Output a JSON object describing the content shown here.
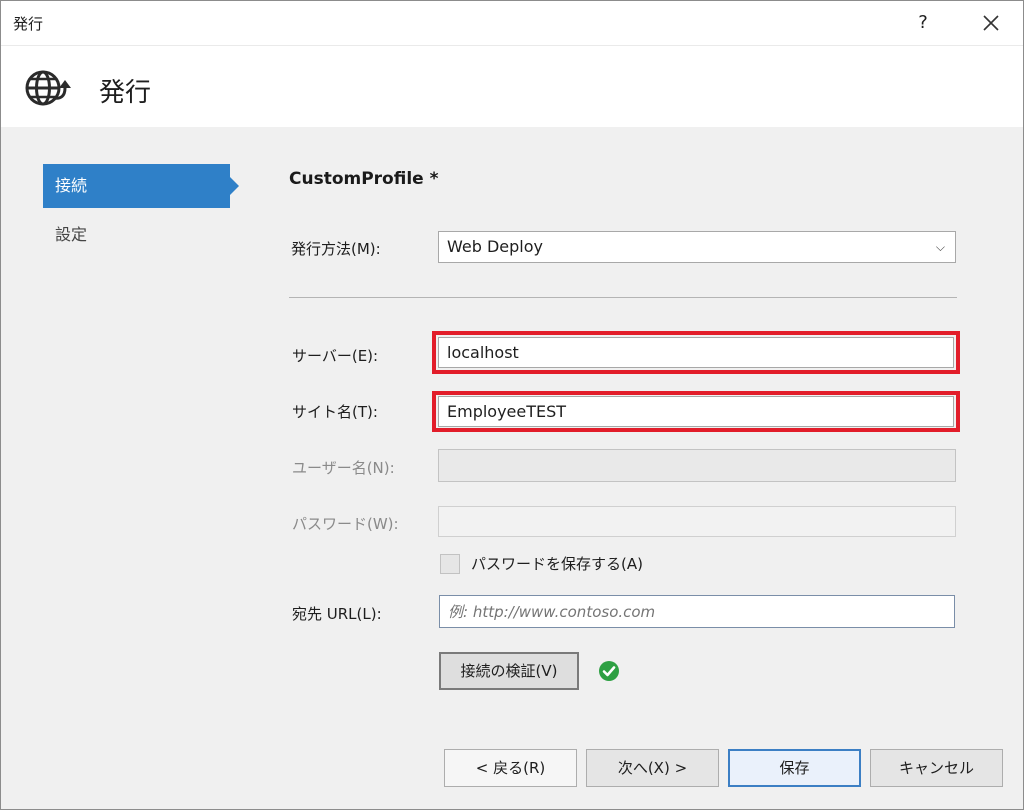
{
  "window": {
    "title": "発行",
    "help_label": "?",
    "heading": "発行"
  },
  "nav": {
    "items": [
      {
        "label": "接続",
        "active": true
      },
      {
        "label": "設定",
        "active": false
      }
    ]
  },
  "profile": {
    "name": "CustomProfile *"
  },
  "form": {
    "method_label": "発行方法(M):",
    "method_value": "Web Deploy",
    "server_label": "サーバー(E):",
    "server_value": "localhost",
    "site_label": "サイト名(T):",
    "site_value": "EmployeeTEST",
    "user_label": "ユーザー名(N):",
    "user_value": "",
    "password_label": "パスワード(W):",
    "password_value": "",
    "save_password_label": "パスワードを保存する(A)",
    "url_label": "宛先 URL(L):",
    "url_placeholder": "例: http://www.contoso.com",
    "validate_label": "接続の検証(V)"
  },
  "footer": {
    "back_label": "< 戻る(R)",
    "next_label": "次へ(X) >",
    "save_label": "保存",
    "cancel_label": "キャンセル"
  },
  "colors": {
    "accent": "#2f80c8",
    "highlight": "#e21d2a",
    "success": "#2ea043"
  },
  "icons": {
    "header": "globe-publish-icon",
    "validation": "check-circle-icon",
    "dropdown": "chevron-down-icon",
    "close": "close-icon"
  }
}
